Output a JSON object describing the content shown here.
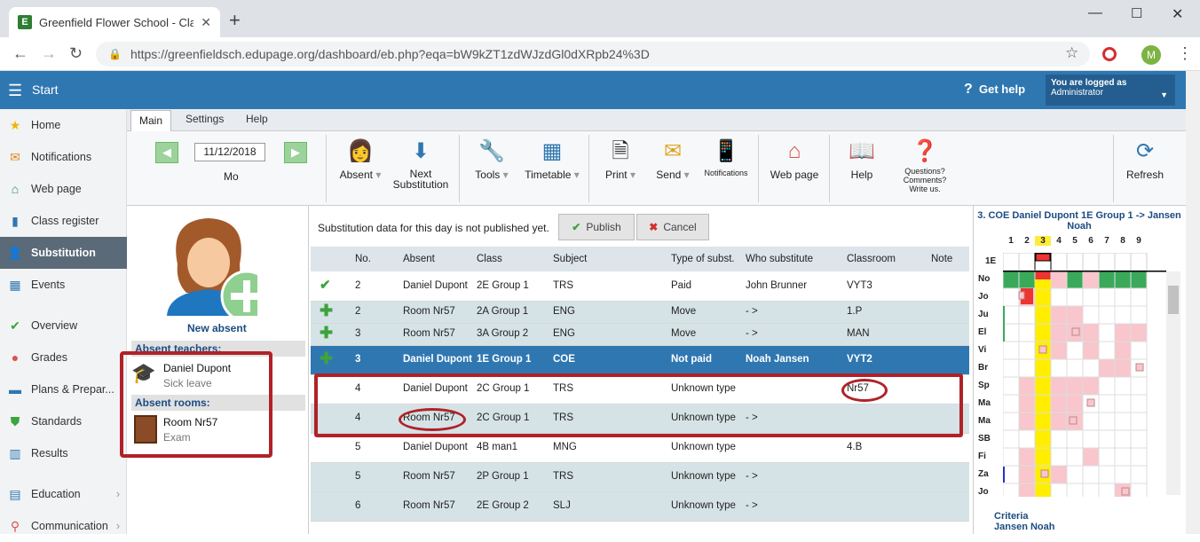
{
  "browser": {
    "tab_title": "Greenfield Flower School - Class",
    "url": "https://greenfieldsch.edupage.org/dashboard/eb.php?eqa=bW9kZT1zdWJzdGl0dXRpb24%3D",
    "profile_initial": "M"
  },
  "header": {
    "start": "Start",
    "help": "Get help",
    "logged_as": "You are logged as",
    "role": "Administrator"
  },
  "sidebar": [
    {
      "label": "Home",
      "icon": "star-icon"
    },
    {
      "label": "Notifications",
      "icon": "envelope-icon"
    },
    {
      "label": "Web page",
      "icon": "house-icon"
    },
    {
      "label": "Class register",
      "icon": "book-icon"
    },
    {
      "label": "Substitution",
      "icon": "user-icon"
    },
    {
      "label": "Events",
      "icon": "calendar-icon"
    },
    {
      "label": "Overview",
      "icon": "check-circle-icon"
    },
    {
      "label": "Grades",
      "icon": "grades-icon"
    },
    {
      "label": "Plans & Prepar...",
      "icon": "briefcase-icon"
    },
    {
      "label": "Standards",
      "icon": "shield-icon"
    },
    {
      "label": "Results",
      "icon": "bar-chart-icon"
    },
    {
      "label": "Education",
      "icon": "education-icon"
    },
    {
      "label": "Communication",
      "icon": "pin-icon"
    }
  ],
  "ribbon": {
    "tabs": [
      "Main",
      "Settings",
      "Help"
    ],
    "date": "11/12/2018",
    "day": "Mo",
    "absent": "Absent",
    "next1": "Next",
    "next2": "Substitution",
    "tools": "Tools",
    "timetable": "Timetable",
    "print": "Print",
    "send": "Send",
    "notifications": "Notifications",
    "webpage": "Web page",
    "help": "Help",
    "questions": "Questions? Comments? Write us.",
    "refresh": "Refresh"
  },
  "left": {
    "new_absent": "New absent",
    "absent_teachers": "Absent teachers:",
    "teacher_name": "Daniel Dupont",
    "teacher_reason": "Sick leave",
    "absent_rooms": "Absent rooms:",
    "room_name": "Room Nr57",
    "room_reason": "Exam"
  },
  "notice": "Substitution data for this day is not published yet.",
  "publish": "Publish",
  "cancel": "Cancel",
  "table": {
    "headers": [
      "No.",
      "Absent",
      "Class",
      "Subject",
      "Type of subst.",
      "Who substitute",
      "Classroom",
      "Note"
    ],
    "rows": [
      {
        "mark": "check",
        "no": "2",
        "absent": "Daniel Dupont",
        "class": "2E Group 1",
        "subject": "TRS",
        "type": "Paid",
        "who": "John Brunner",
        "room": "VYT3",
        "style": "w"
      },
      {
        "mark": "plus",
        "no": "2",
        "absent": "Room Nr57",
        "class": "2A Group 1",
        "subject": "ENG",
        "type": "Move",
        "who": "- >",
        "room": "1.P",
        "style": "g"
      },
      {
        "mark": "plus",
        "no": "3",
        "absent": "Room Nr57",
        "class": "3A Group 2",
        "subject": "ENG",
        "type": "Move",
        "who": "- >",
        "room": "MAN",
        "style": "g"
      },
      {
        "mark": "plus",
        "no": "3",
        "absent": "Daniel Dupont",
        "class": "1E Group 1",
        "subject": "COE",
        "type": "Not paid",
        "who": "Noah Jansen",
        "room": "VYT2",
        "style": "sel"
      },
      {
        "mark": "",
        "no": "4",
        "absent": "Daniel Dupont",
        "class": "2C Group 1",
        "subject": "TRS",
        "type": "Unknown type",
        "who": "",
        "room": "Nr57",
        "style": "w"
      },
      {
        "mark": "",
        "no": "4",
        "absent": "Room Nr57",
        "class": "2C Group 1",
        "subject": "TRS",
        "type": "Unknown type",
        "who": "- >",
        "room": "",
        "style": "g"
      },
      {
        "mark": "",
        "no": "5",
        "absent": "Daniel Dupont",
        "class": "4B man1",
        "subject": "MNG",
        "type": "Unknown type",
        "who": "",
        "room": "4.B",
        "style": "w"
      },
      {
        "mark": "",
        "no": "5",
        "absent": "Room Nr57",
        "class": "2P Group 1",
        "subject": "TRS",
        "type": "Unknown type",
        "who": "- >",
        "room": "",
        "style": "g"
      },
      {
        "mark": "",
        "no": "6",
        "absent": "Room Nr57",
        "class": "2E Group 2",
        "subject": "SLJ",
        "type": "Unknown type",
        "who": "- >",
        "room": "",
        "style": "g"
      }
    ]
  },
  "right": {
    "title": "3. COE Daniel Dupont 1E Group 1 -> Jansen Noah",
    "periods": [
      "1",
      "2",
      "3",
      "4",
      "5",
      "6",
      "7",
      "8",
      "9"
    ],
    "class_label": "1E",
    "teachers": [
      "No",
      "Jo",
      "Ju",
      "El",
      "Vi",
      "Br",
      "Sp",
      "Ma",
      "Ma",
      "SB",
      "Fi",
      "Za",
      "Jo"
    ],
    "criteria": "Criteria",
    "criteria_name": "Jansen Noah"
  },
  "colors": {
    "header": "#2f77b1",
    "accent_red": "#b02228",
    "selected_row": "#2f77b1",
    "row_tint": "#d5e3e6"
  }
}
